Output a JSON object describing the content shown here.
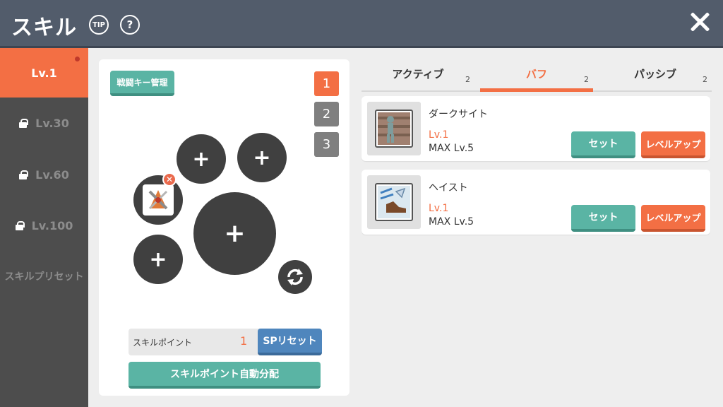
{
  "header": {
    "title": "スキル",
    "tip_label": "TIP",
    "help_label": "?"
  },
  "sidebar": {
    "items": [
      {
        "label": "Lv.1",
        "locked": false,
        "active": true
      },
      {
        "label": "Lv.30",
        "locked": true
      },
      {
        "label": "Lv.60",
        "locked": true
      },
      {
        "label": "Lv.100",
        "locked": true
      },
      {
        "label": "スキルプリセット",
        "locked": false
      }
    ]
  },
  "preset_panel": {
    "battle_key_label": "戦闘キー管理",
    "presets": [
      "1",
      "2",
      "3"
    ],
    "active_preset": "1",
    "slot_plus": "+",
    "remove_label": "✕",
    "skill_points_label": "スキルポイント",
    "skill_points_value": "1",
    "sp_reset_label": "SPリセット",
    "auto_assign_label": "スキルポイント自動分配"
  },
  "tabs": [
    {
      "label": "アクティブ",
      "count": "2",
      "active": false
    },
    {
      "label": "バフ",
      "count": "2",
      "active": true
    },
    {
      "label": "パッシブ",
      "count": "2",
      "active": false
    }
  ],
  "skills": [
    {
      "name": "ダークサイト",
      "level": "Lv.1",
      "max": "MAX Lv.5",
      "set_label": "セット",
      "levelup_label": "レベルアップ",
      "icon": "dark-sight-icon"
    },
    {
      "name": "ヘイスト",
      "level": "Lv.1",
      "max": "MAX Lv.5",
      "set_label": "セット",
      "levelup_label": "レベルアップ",
      "icon": "haste-icon"
    }
  ],
  "colors": {
    "accent": "#f36f44",
    "teal": "#5ab4a4",
    "blue": "#4f86bd",
    "header": "#525c6b",
    "sidebar": "#4d4d4d"
  }
}
